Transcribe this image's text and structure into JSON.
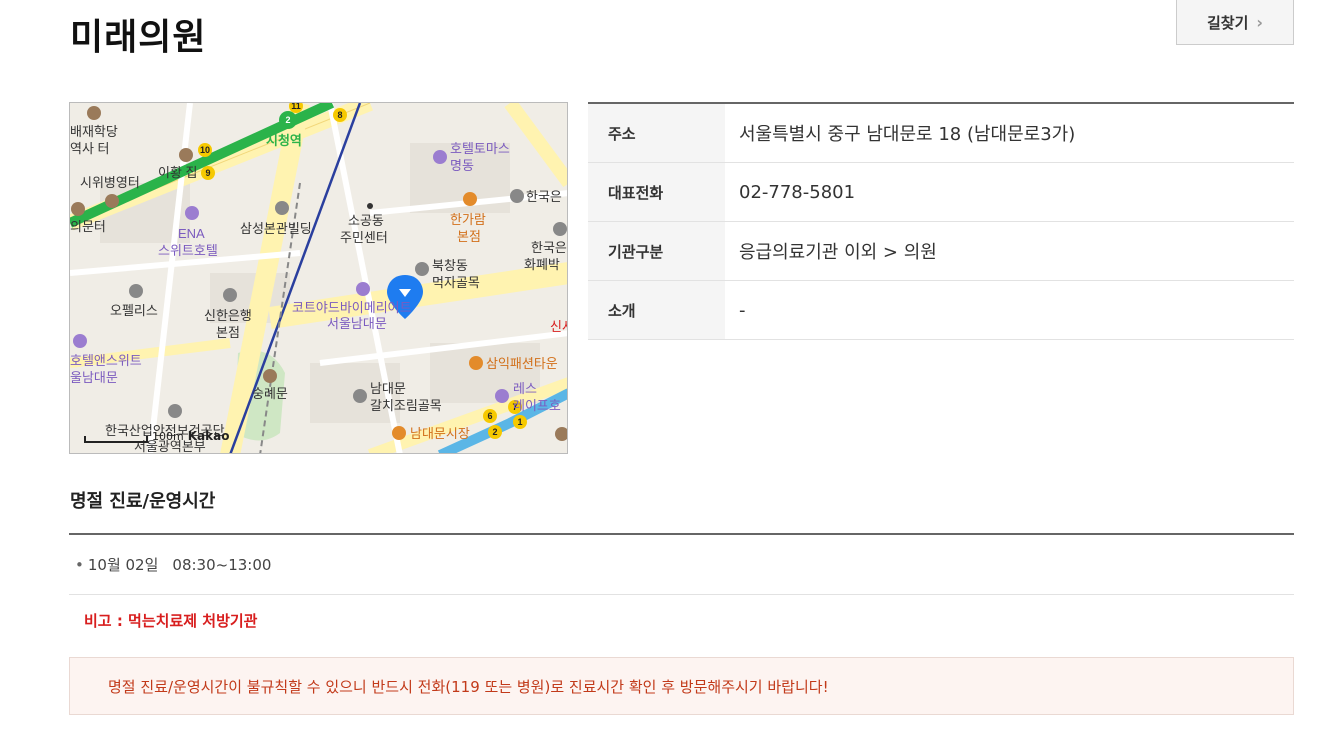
{
  "page": {
    "title": "미래의원"
  },
  "actions": {
    "directions_label": "길찾기",
    "directions_icon": "chevron-right-icon"
  },
  "map": {
    "scale_label": "100m",
    "brand": "Kakao",
    "labels": {
      "baejae": "배재학당",
      "yeoksa": "역사 터",
      "ihwang": "이황 집",
      "siwi": "시위병영터",
      "munter": "의문터",
      "cityhall_station": "시청역",
      "ena": "ENA",
      "suite_hotel": "스위트호텔",
      "samsung": "삼성본관빌딩",
      "sogong": "소공동",
      "jumin": "주민센터",
      "hotel_tomas": "호텔토마스",
      "myeongdong": "명동",
      "hangaram": "한가람",
      "bonjeom": "본점",
      "bank_korea": "한국은",
      "bank_korea2": "한국은",
      "hwapye": "화폐박",
      "opellis": "오펠리스",
      "shinhan": "신한은행",
      "shinhan_bonjeom": "본점",
      "bukchang": "북창동",
      "meokja": "먹자골목",
      "courtyard": "코트야드바이메리어트",
      "courtyard2": "서울남대문",
      "hotel_ands": "호텔앤스위트",
      "namdaemun_w": "울남대문",
      "sungnyemun": "숭례문",
      "namdaemun_galchi": "남대문",
      "galchi": "갈치조림골목",
      "samik": "삼익패션타운",
      "res": "레스",
      "ipeuho": "레이프호",
      "namdaemun_market": "남대문시장",
      "kosha": "한국산업안전보건공단",
      "seoul_office": "서울광역본부",
      "sin": "신사"
    },
    "line_numbers": [
      "2",
      "11",
      "8",
      "10",
      "9",
      "6",
      "7",
      "1",
      "2"
    ]
  },
  "info": {
    "rows": [
      {
        "label": "주소",
        "value": "서울특별시 중구 남대문로 18 (남대문로3가)"
      },
      {
        "label": "대표전화",
        "value": "02-778-5801"
      },
      {
        "label": "기관구분",
        "value": "응급의료기관 이외 > 의원"
      },
      {
        "label": "소개",
        "value": "-"
      }
    ]
  },
  "hours": {
    "section_title": "명절 진료/운영시간",
    "entries": [
      {
        "date": "10월 02일",
        "time": "08:30~13:00"
      }
    ],
    "remark": "비고 : 먹는치료제 처방기관",
    "notice": "명절 진료/운영시간이 불규칙할 수 있으니 반드시 전화(119 또는 병원)로 진료시간 확인 후 방문해주시기 바랍니다!"
  },
  "colors": {
    "remark": "#d81e1e",
    "notice_text": "#c23a1a",
    "notice_bg": "#fdf4f1",
    "pin": "#1e7cf0",
    "subway_line2": "#2bb34a",
    "subway_line1": "#2a3f9e"
  }
}
